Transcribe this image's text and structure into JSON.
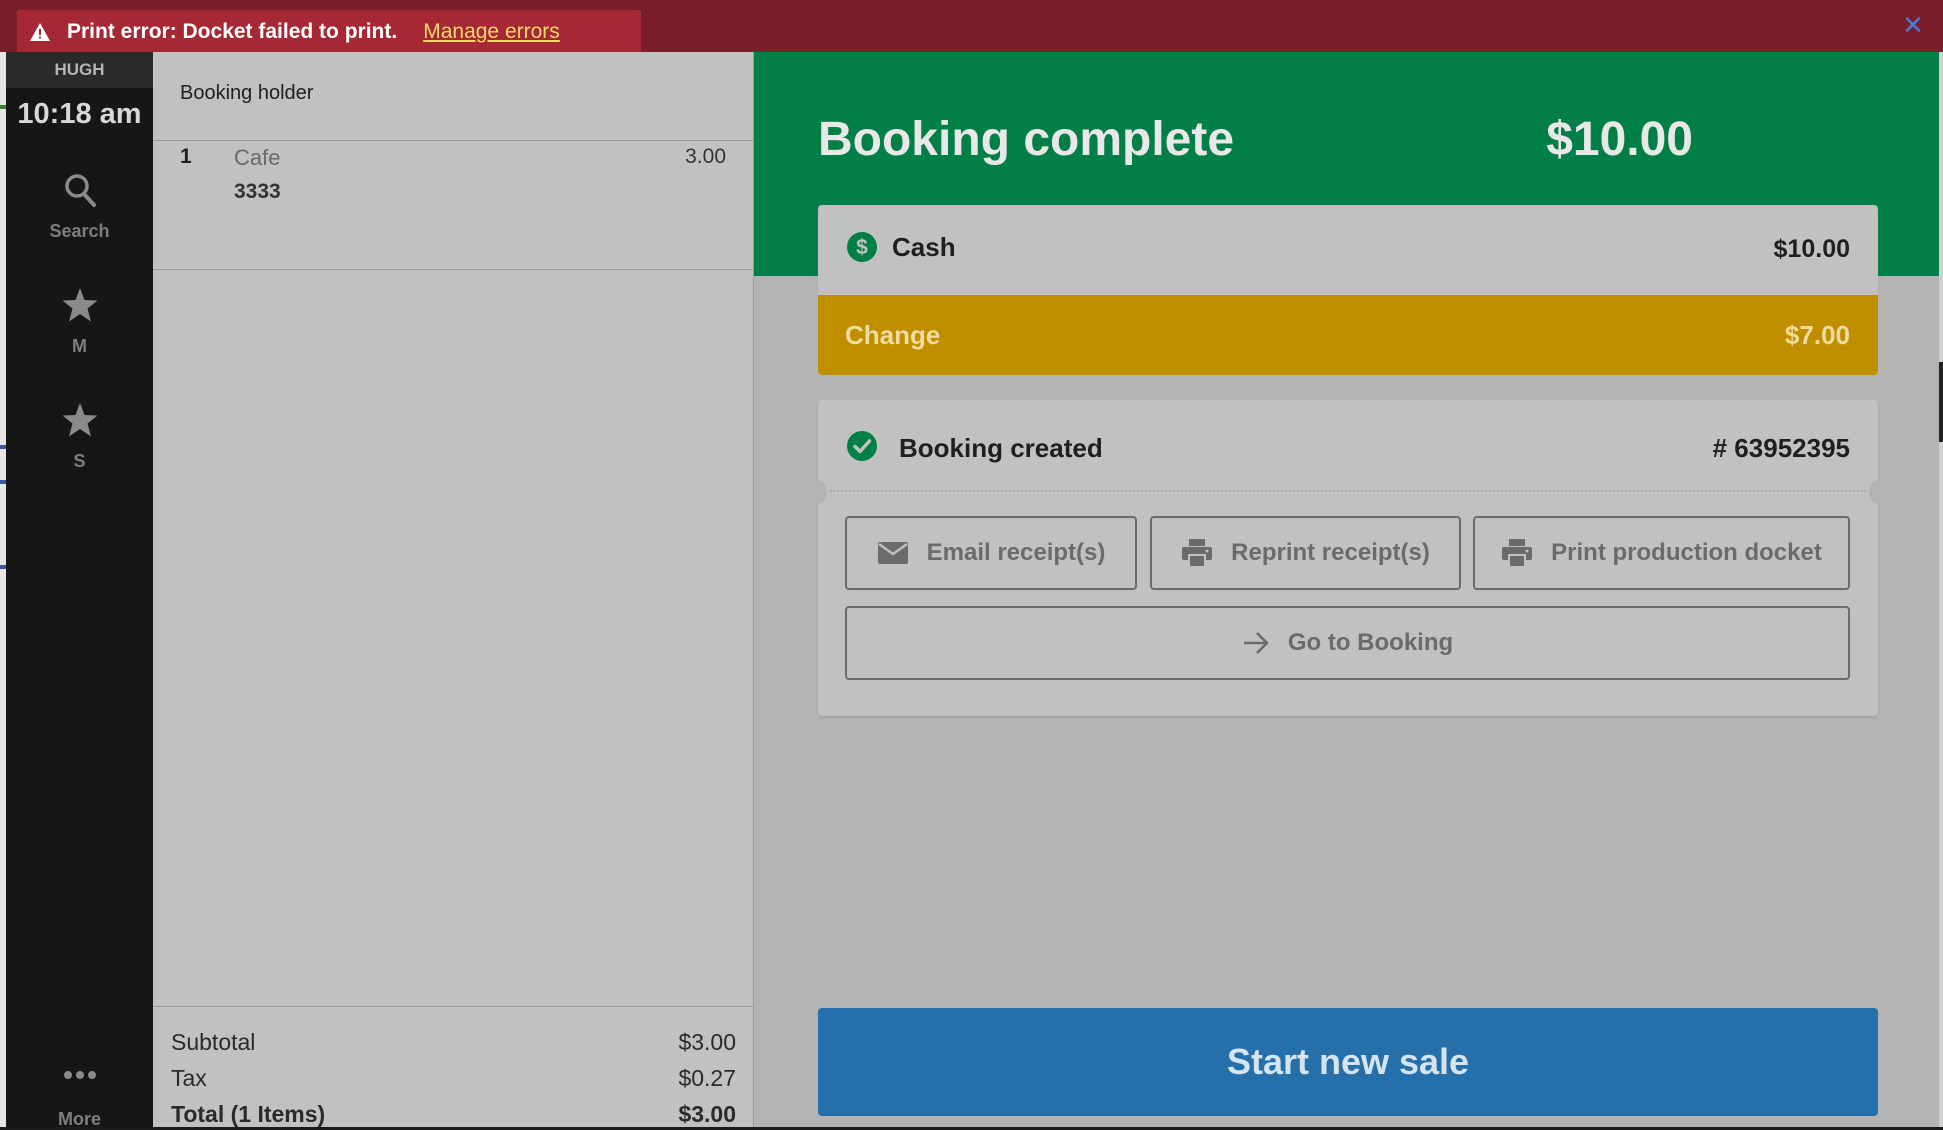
{
  "error_banner": {
    "message": "Print error: Docket failed to print.",
    "link_label": "Manage errors",
    "close_glyph": "✕",
    "colors": {
      "banner_bg": "#7a1f2a",
      "toast_bg": "#a52834",
      "link": "#f5d76e"
    }
  },
  "sidebar": {
    "user": "HUGH",
    "time": "10:18 am",
    "items": [
      {
        "label": "Search",
        "icon": "search-icon"
      },
      {
        "label": "M",
        "icon": "star-icon"
      },
      {
        "label": "S",
        "icon": "star-icon"
      },
      {
        "label": "More",
        "icon": "more-dots-icon"
      }
    ]
  },
  "cart": {
    "booking_holder_label": "Booking holder",
    "line_items": [
      {
        "qty": "1",
        "name": "Cafe",
        "price": "3.00",
        "code": "3333"
      }
    ],
    "totals": {
      "subtotal_label": "Subtotal",
      "subtotal_value": "$3.00",
      "tax_label": "Tax",
      "tax_value": "$0.27",
      "total_label": "Total (1 Items)",
      "total_value": "$3.00"
    }
  },
  "completion": {
    "title": "Booking complete",
    "amount": "$10.00",
    "payment": {
      "method": "Cash",
      "amount": "$10.00",
      "icon": "dollar-circle-icon"
    },
    "change": {
      "label": "Change",
      "amount": "$7.00"
    },
    "booking_created": {
      "label": "Booking created",
      "number": "# 63952395",
      "icon": "check-circle-icon"
    },
    "actions": {
      "email_receipts": "Email receipt(s)",
      "reprint_receipts": "Reprint receipt(s)",
      "print_production_docket": "Print production docket",
      "go_to_booking": "Go to Booking"
    },
    "start_new_sale": "Start new sale",
    "colors": {
      "header_green": "#027f47",
      "change_gold": "#bf8f00",
      "primary_blue": "#2570ab"
    }
  }
}
